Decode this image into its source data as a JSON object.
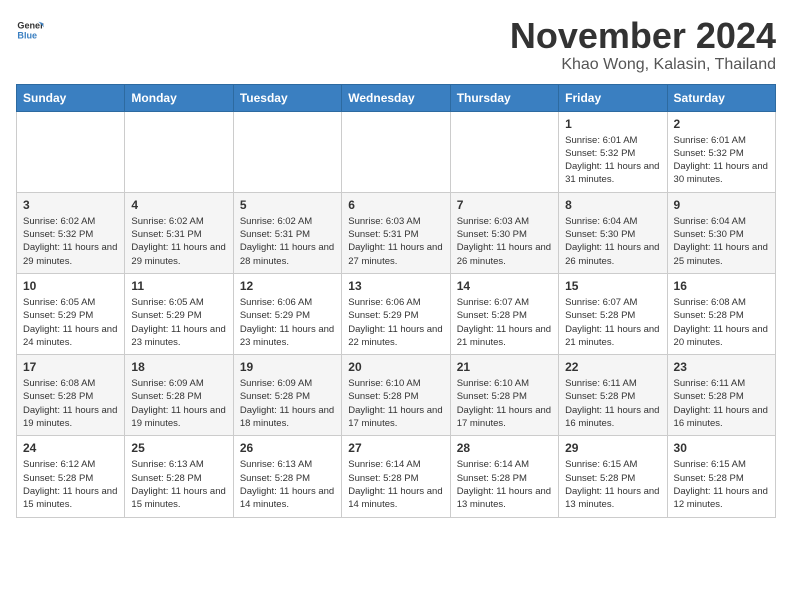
{
  "header": {
    "logo_line1": "General",
    "logo_line2": "Blue",
    "month": "November 2024",
    "location": "Khao Wong, Kalasin, Thailand"
  },
  "days_of_week": [
    "Sunday",
    "Monday",
    "Tuesday",
    "Wednesday",
    "Thursday",
    "Friday",
    "Saturday"
  ],
  "weeks": [
    [
      {
        "day": "",
        "info": ""
      },
      {
        "day": "",
        "info": ""
      },
      {
        "day": "",
        "info": ""
      },
      {
        "day": "",
        "info": ""
      },
      {
        "day": "",
        "info": ""
      },
      {
        "day": "1",
        "info": "Sunrise: 6:01 AM\nSunset: 5:32 PM\nDaylight: 11 hours and 31 minutes."
      },
      {
        "day": "2",
        "info": "Sunrise: 6:01 AM\nSunset: 5:32 PM\nDaylight: 11 hours and 30 minutes."
      }
    ],
    [
      {
        "day": "3",
        "info": "Sunrise: 6:02 AM\nSunset: 5:32 PM\nDaylight: 11 hours and 29 minutes."
      },
      {
        "day": "4",
        "info": "Sunrise: 6:02 AM\nSunset: 5:31 PM\nDaylight: 11 hours and 29 minutes."
      },
      {
        "day": "5",
        "info": "Sunrise: 6:02 AM\nSunset: 5:31 PM\nDaylight: 11 hours and 28 minutes."
      },
      {
        "day": "6",
        "info": "Sunrise: 6:03 AM\nSunset: 5:31 PM\nDaylight: 11 hours and 27 minutes."
      },
      {
        "day": "7",
        "info": "Sunrise: 6:03 AM\nSunset: 5:30 PM\nDaylight: 11 hours and 26 minutes."
      },
      {
        "day": "8",
        "info": "Sunrise: 6:04 AM\nSunset: 5:30 PM\nDaylight: 11 hours and 26 minutes."
      },
      {
        "day": "9",
        "info": "Sunrise: 6:04 AM\nSunset: 5:30 PM\nDaylight: 11 hours and 25 minutes."
      }
    ],
    [
      {
        "day": "10",
        "info": "Sunrise: 6:05 AM\nSunset: 5:29 PM\nDaylight: 11 hours and 24 minutes."
      },
      {
        "day": "11",
        "info": "Sunrise: 6:05 AM\nSunset: 5:29 PM\nDaylight: 11 hours and 23 minutes."
      },
      {
        "day": "12",
        "info": "Sunrise: 6:06 AM\nSunset: 5:29 PM\nDaylight: 11 hours and 23 minutes."
      },
      {
        "day": "13",
        "info": "Sunrise: 6:06 AM\nSunset: 5:29 PM\nDaylight: 11 hours and 22 minutes."
      },
      {
        "day": "14",
        "info": "Sunrise: 6:07 AM\nSunset: 5:28 PM\nDaylight: 11 hours and 21 minutes."
      },
      {
        "day": "15",
        "info": "Sunrise: 6:07 AM\nSunset: 5:28 PM\nDaylight: 11 hours and 21 minutes."
      },
      {
        "day": "16",
        "info": "Sunrise: 6:08 AM\nSunset: 5:28 PM\nDaylight: 11 hours and 20 minutes."
      }
    ],
    [
      {
        "day": "17",
        "info": "Sunrise: 6:08 AM\nSunset: 5:28 PM\nDaylight: 11 hours and 19 minutes."
      },
      {
        "day": "18",
        "info": "Sunrise: 6:09 AM\nSunset: 5:28 PM\nDaylight: 11 hours and 19 minutes."
      },
      {
        "day": "19",
        "info": "Sunrise: 6:09 AM\nSunset: 5:28 PM\nDaylight: 11 hours and 18 minutes."
      },
      {
        "day": "20",
        "info": "Sunrise: 6:10 AM\nSunset: 5:28 PM\nDaylight: 11 hours and 17 minutes."
      },
      {
        "day": "21",
        "info": "Sunrise: 6:10 AM\nSunset: 5:28 PM\nDaylight: 11 hours and 17 minutes."
      },
      {
        "day": "22",
        "info": "Sunrise: 6:11 AM\nSunset: 5:28 PM\nDaylight: 11 hours and 16 minutes."
      },
      {
        "day": "23",
        "info": "Sunrise: 6:11 AM\nSunset: 5:28 PM\nDaylight: 11 hours and 16 minutes."
      }
    ],
    [
      {
        "day": "24",
        "info": "Sunrise: 6:12 AM\nSunset: 5:28 PM\nDaylight: 11 hours and 15 minutes."
      },
      {
        "day": "25",
        "info": "Sunrise: 6:13 AM\nSunset: 5:28 PM\nDaylight: 11 hours and 15 minutes."
      },
      {
        "day": "26",
        "info": "Sunrise: 6:13 AM\nSunset: 5:28 PM\nDaylight: 11 hours and 14 minutes."
      },
      {
        "day": "27",
        "info": "Sunrise: 6:14 AM\nSunset: 5:28 PM\nDaylight: 11 hours and 14 minutes."
      },
      {
        "day": "28",
        "info": "Sunrise: 6:14 AM\nSunset: 5:28 PM\nDaylight: 11 hours and 13 minutes."
      },
      {
        "day": "29",
        "info": "Sunrise: 6:15 AM\nSunset: 5:28 PM\nDaylight: 11 hours and 13 minutes."
      },
      {
        "day": "30",
        "info": "Sunrise: 6:15 AM\nSunset: 5:28 PM\nDaylight: 11 hours and 12 minutes."
      }
    ]
  ]
}
